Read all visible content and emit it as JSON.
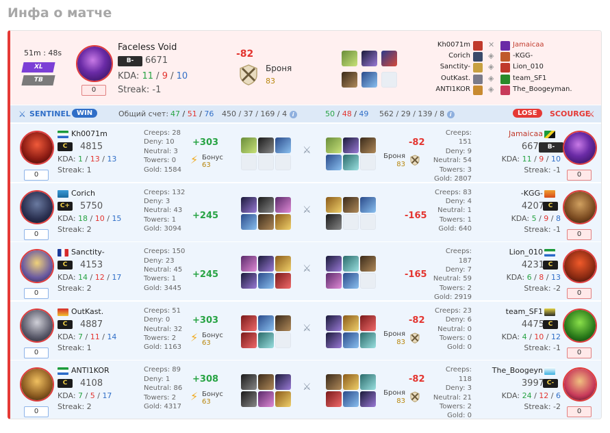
{
  "title": "Инфа о матче",
  "summary": {
    "duration": "51m : 48s",
    "tag_xl": "XL",
    "tag_tb": "TB",
    "badge": "0",
    "hero_name": "Faceless Void",
    "rank": "B-",
    "mmr": "6671",
    "kda_label": "KDA:",
    "kda": {
      "k": "11",
      "d": "9",
      "a": "10"
    },
    "streak": "Streak: -1",
    "delta": "-82",
    "armor_label": "Броня",
    "armor_value": "83",
    "matchups": [
      {
        "left": "Kh0071m",
        "right": "Jamaicaa",
        "right_highlight": true
      },
      {
        "left": "Corich",
        "right": "-KGG-"
      },
      {
        "left": "Sanctity-",
        "right": "Lion_010"
      },
      {
        "left": "OutKast.",
        "right": "team_SF1"
      },
      {
        "left": "ANTI1KOR",
        "right": "The_Boogeyman."
      }
    ]
  },
  "teams": {
    "sentinel": "SENTINEL",
    "win": "WIN",
    "score_label": "Общий счет:",
    "sentinel_kda": {
      "k": "47",
      "d": "51",
      "a": "76"
    },
    "sentinel_totals": "450 / 37 / 169 / 4",
    "scourge_kda": {
      "k": "50",
      "d": "48",
      "a": "49"
    },
    "scourge_totals": "562 / 29 / 139 / 8",
    "lose": "LOSE",
    "scourge": "SCOURGE"
  },
  "rows": [
    {
      "left": {
        "name": "Kh0071m",
        "rank": "C",
        "mmr": "4815",
        "kda": {
          "k": "1",
          "d": "13",
          "a": "13"
        },
        "streak": "Streak: 1",
        "badge": "0",
        "stats": [
          "Creeps: 28",
          "Deny: 10",
          "Neutral: 3",
          "Towers: 0",
          "Gold: 1584"
        ],
        "gain": "+303",
        "bonus": "Бонус",
        "bonus_val": "63"
      },
      "right": {
        "name": "Jamaicaa",
        "rank": "B-",
        "mmr": "6671",
        "kda": {
          "k": "11",
          "d": "9",
          "a": "10"
        },
        "streak": "Streak: -1",
        "badge": "0",
        "stats": [
          "Creeps: 151",
          "Deny: 9",
          "Neutral: 54",
          "Towers: 3",
          "Gold: 2807"
        ],
        "loss": "-82",
        "armor": "Броня",
        "armor_val": "83"
      }
    },
    {
      "left": {
        "name": "Corich",
        "rank": "C+",
        "mmr": "5750",
        "kda": {
          "k": "18",
          "d": "10",
          "a": "15"
        },
        "streak": "Streak: 2",
        "badge": "0",
        "stats": [
          "Creeps: 132",
          "Deny: 3",
          "Neutral: 43",
          "Towers: 1",
          "Gold: 3094"
        ],
        "gain": "+245"
      },
      "right": {
        "name": "-KGG-",
        "rank": "C",
        "mmr": "4207",
        "kda": {
          "k": "5",
          "d": "9",
          "a": "8"
        },
        "streak": "Streak: -1",
        "badge": "0",
        "stats": [
          "Creeps: 83",
          "Deny: 4",
          "Neutral: 1",
          "Towers: 1",
          "Gold: 640"
        ],
        "loss": "-165"
      }
    },
    {
      "left": {
        "name": "Sanctity-",
        "rank": "C",
        "mmr": "4153",
        "kda": {
          "k": "14",
          "d": "12",
          "a": "17"
        },
        "streak": "Streak: 2",
        "badge": "0",
        "stats": [
          "Creeps: 150",
          "Deny: 23",
          "Neutral: 45",
          "Towers: 1",
          "Gold: 3445"
        ],
        "gain": "+245"
      },
      "right": {
        "name": "Lion_010",
        "rank": "C",
        "mmr": "4231",
        "kda": {
          "k": "6",
          "d": "8",
          "a": "13"
        },
        "streak": "Streak: -2",
        "badge": "0",
        "stats": [
          "Creeps: 187",
          "Deny: 7",
          "Neutral: 59",
          "Towers: 2",
          "Gold: 2919"
        ],
        "loss": "-165"
      }
    },
    {
      "left": {
        "name": "OutKast.",
        "rank": "C",
        "mmr": "4887",
        "kda": {
          "k": "7",
          "d": "11",
          "a": "14"
        },
        "streak": "Streak: 1",
        "badge": "0",
        "stats": [
          "Creeps: 51",
          "Deny: 0",
          "Neutral: 32",
          "Towers: 2",
          "Gold: 1163"
        ],
        "gain": "+303",
        "bonus": "Бонус",
        "bonus_val": "63"
      },
      "right": {
        "name": "team_SF1",
        "rank": "C",
        "mmr": "4475",
        "kda": {
          "k": "4",
          "d": "10",
          "a": "12"
        },
        "streak": "Streak: -1",
        "badge": "0",
        "stats": [
          "Creeps: 23",
          "Deny: 6",
          "Neutral: 0",
          "Towers: 0",
          "Gold: 0"
        ],
        "loss": "-82",
        "armor": "Броня",
        "armor_val": "83"
      }
    },
    {
      "left": {
        "name": "ANTI1KOR",
        "rank": "C",
        "mmr": "4108",
        "kda": {
          "k": "7",
          "d": "5",
          "a": "17"
        },
        "streak": "Streak: 2",
        "badge": "0",
        "stats": [
          "Creeps: 89",
          "Deny: 1",
          "Neutral: 86",
          "Towers: 2",
          "Gold: 4317"
        ],
        "gain": "+308",
        "bonus": "Бонус",
        "bonus_val": "63"
      },
      "right": {
        "name": "The_Boogeyn",
        "rank": "C-",
        "mmr": "3997",
        "kda": {
          "k": "24",
          "d": "12",
          "a": "6"
        },
        "streak": "Streak: -2",
        "badge": "0",
        "stats": [
          "Creeps: 118",
          "Deny: 3",
          "Neutral: 21",
          "Towers: 2",
          "Gold: 0"
        ],
        "loss": "-82",
        "armor": "Броня",
        "armor_val": "83"
      }
    }
  ]
}
